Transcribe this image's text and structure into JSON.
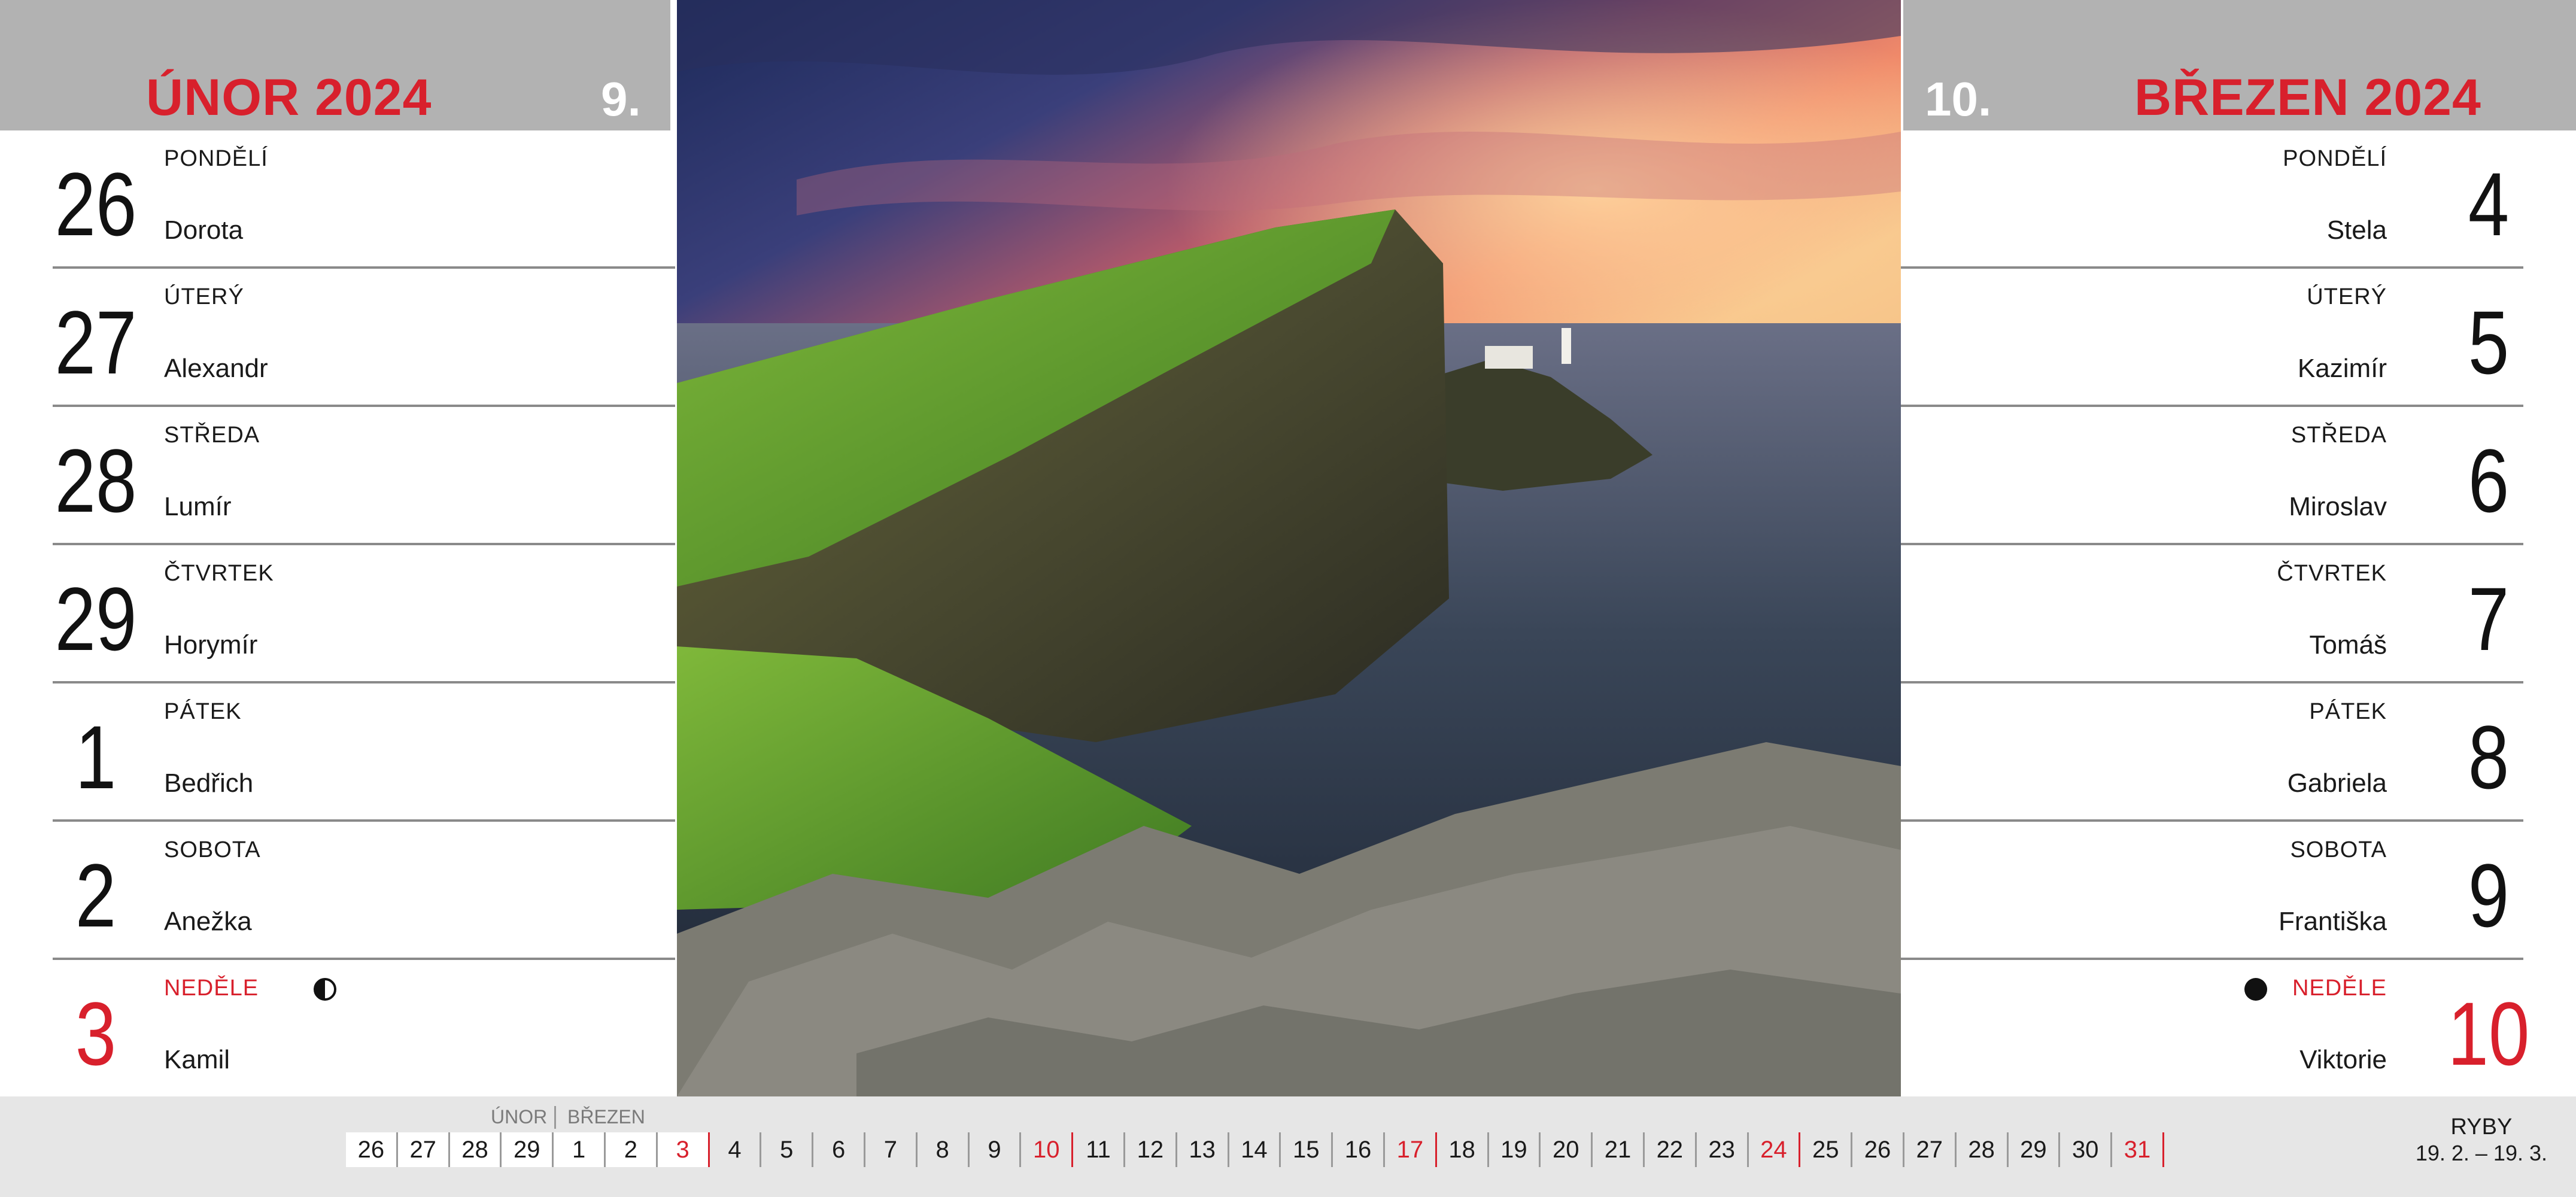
{
  "left": {
    "month_title": "ÚNOR 2024",
    "week": "9.",
    "days": [
      {
        "num": "26",
        "day": "PONDĚLÍ",
        "name": "Dorota"
      },
      {
        "num": "27",
        "day": "ÚTERÝ",
        "name": "Alexandr"
      },
      {
        "num": "28",
        "day": "STŘEDA",
        "name": "Lumír"
      },
      {
        "num": "29",
        "day": "ČTVRTEK",
        "name": "Horymír"
      },
      {
        "num": "1",
        "day": "PÁTEK",
        "name": "Bedřich"
      },
      {
        "num": "2",
        "day": "SOBOTA",
        "name": "Anežka"
      },
      {
        "num": "3",
        "day": "NEDĚLE",
        "name": "Kamil"
      }
    ]
  },
  "right": {
    "month_title": "BŘEZEN 2024",
    "week": "10.",
    "days": [
      {
        "num": "4",
        "day": "PONDĚLÍ",
        "name": "Stela"
      },
      {
        "num": "5",
        "day": "ÚTERÝ",
        "name": "Kazimír"
      },
      {
        "num": "6",
        "day": "STŘEDA",
        "name": "Miroslav"
      },
      {
        "num": "7",
        "day": "ČTVRTEK",
        "name": "Tomáš"
      },
      {
        "num": "8",
        "day": "PÁTEK",
        "name": "Gabriela"
      },
      {
        "num": "9",
        "day": "SOBOTA",
        "name": "Františka"
      },
      {
        "num": "10",
        "day": "NEDĚLE",
        "name": "Viktorie"
      }
    ]
  },
  "moon_icons": {
    "left_sunday": "first-quarter-moon-icon",
    "right_sunday": "new-moon-icon"
  },
  "colors": {
    "accent_red": "#d8202c",
    "header_grey": "#b2b2b2",
    "strip_grey": "#e6e6e6"
  },
  "mini_calendar": {
    "month_labels": {
      "prev": "ÚNOR",
      "next": "BŘEZEN"
    },
    "days": [
      {
        "n": "26",
        "red": false,
        "grey": false
      },
      {
        "n": "27",
        "red": false,
        "grey": false
      },
      {
        "n": "28",
        "red": false,
        "grey": false
      },
      {
        "n": "29",
        "red": false,
        "grey": false
      },
      {
        "n": "1",
        "red": false,
        "grey": false
      },
      {
        "n": "2",
        "red": false,
        "grey": false
      },
      {
        "n": "3",
        "red": true,
        "grey": false
      },
      {
        "n": "4",
        "red": false,
        "grey": true
      },
      {
        "n": "5",
        "red": false,
        "grey": true
      },
      {
        "n": "6",
        "red": false,
        "grey": true
      },
      {
        "n": "7",
        "red": false,
        "grey": true
      },
      {
        "n": "8",
        "red": false,
        "grey": true
      },
      {
        "n": "9",
        "red": false,
        "grey": true
      },
      {
        "n": "10",
        "red": true,
        "grey": true
      },
      {
        "n": "11",
        "red": false,
        "grey": true
      },
      {
        "n": "12",
        "red": false,
        "grey": true
      },
      {
        "n": "13",
        "red": false,
        "grey": true
      },
      {
        "n": "14",
        "red": false,
        "grey": true
      },
      {
        "n": "15",
        "red": false,
        "grey": true
      },
      {
        "n": "16",
        "red": false,
        "grey": true
      },
      {
        "n": "17",
        "red": true,
        "grey": true
      },
      {
        "n": "18",
        "red": false,
        "grey": true
      },
      {
        "n": "19",
        "red": false,
        "grey": true
      },
      {
        "n": "20",
        "red": false,
        "grey": true
      },
      {
        "n": "21",
        "red": false,
        "grey": true
      },
      {
        "n": "22",
        "red": false,
        "grey": true
      },
      {
        "n": "23",
        "red": false,
        "grey": true
      },
      {
        "n": "24",
        "red": true,
        "grey": true
      },
      {
        "n": "25",
        "red": false,
        "grey": true
      },
      {
        "n": "26",
        "red": false,
        "grey": true
      },
      {
        "n": "27",
        "red": false,
        "grey": true
      },
      {
        "n": "28",
        "red": false,
        "grey": true
      },
      {
        "n": "29",
        "red": false,
        "grey": true
      },
      {
        "n": "30",
        "red": false,
        "grey": true
      },
      {
        "n": "31",
        "red": true,
        "grey": true
      }
    ]
  },
  "zodiac": {
    "sign": "RYBY",
    "range": "19. 2. – 19. 3."
  }
}
